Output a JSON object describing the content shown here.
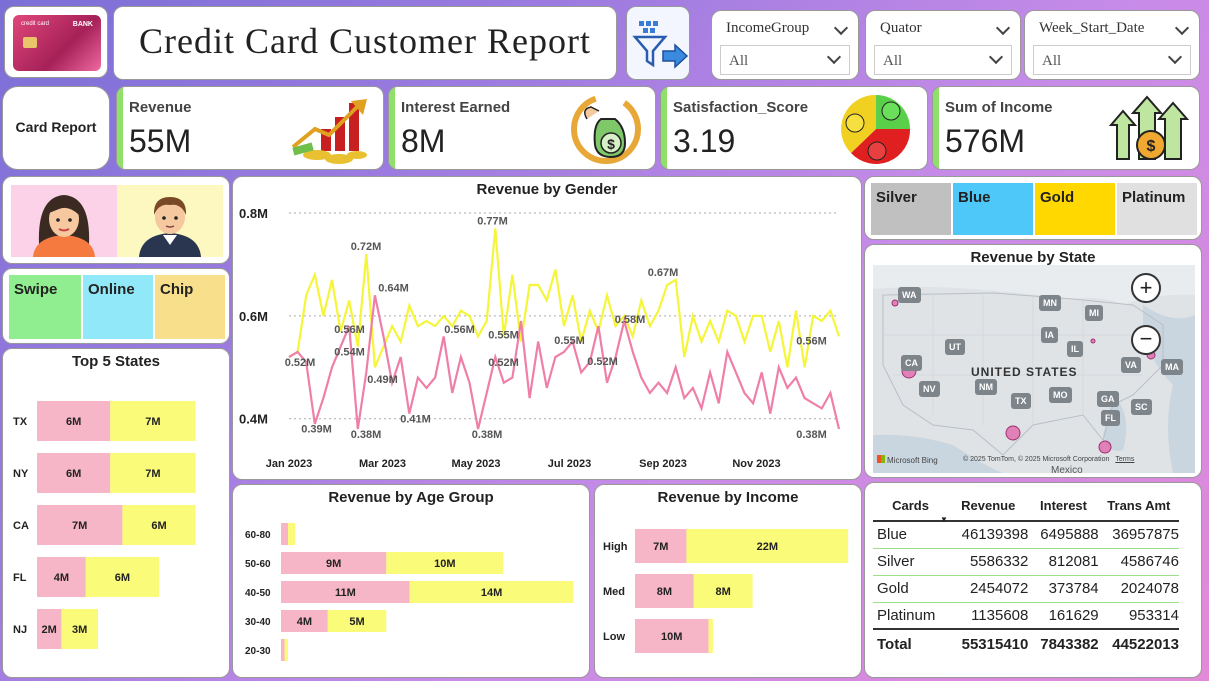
{
  "header": {
    "title": "Credit Card Customer Report",
    "card_image_bank": "BANK",
    "card_image_label": "credit card"
  },
  "slicers": [
    {
      "label": "IncomeGroup",
      "value": "All"
    },
    {
      "label": "Quator",
      "value": "All"
    },
    {
      "label": "Week_Start_Date",
      "value": "All"
    }
  ],
  "nav": {
    "card_report": "Card Report"
  },
  "kpis": [
    {
      "label": "Revenue",
      "value": "55M"
    },
    {
      "label": "Interest Earned",
      "value": "8M"
    },
    {
      "label": "Satisfaction_Score",
      "value": "3.19"
    },
    {
      "label": "Sum of Income",
      "value": "576M"
    }
  ],
  "txn_types": [
    "Swipe",
    "Online",
    "Chip"
  ],
  "card_buttons": [
    "Silver",
    "Blue",
    "Gold",
    "Platinum"
  ],
  "colors": {
    "female": "#f7b6c8",
    "male": "#fbfb7a",
    "line_female": "#ef7fa8",
    "line_male": "#f5f53a",
    "accent": "#8fe06a"
  },
  "top5": {
    "title": "Top 5 States",
    "rows": [
      {
        "state": "TX",
        "f": 6,
        "m": 7,
        "f_label": "6M",
        "m_label": "7M"
      },
      {
        "state": "NY",
        "f": 6,
        "m": 7,
        "f_label": "6M",
        "m_label": "7M"
      },
      {
        "state": "CA",
        "f": 7,
        "m": 6,
        "f_label": "7M",
        "m_label": "6M"
      },
      {
        "state": "FL",
        "f": 4,
        "m": 6,
        "f_label": "4M",
        "m_label": "6M"
      },
      {
        "state": "NJ",
        "f": 2,
        "m": 3,
        "f_label": "2M",
        "m_label": "3M"
      }
    ]
  },
  "gender_chart": {
    "title": "Revenue by Gender",
    "y_ticks": [
      "0.8M",
      "0.6M",
      "0.4M"
    ],
    "x_ticks": [
      "Jan 2023",
      "Mar 2023",
      "May 2023",
      "Jul 2023",
      "Sep 2023",
      "Nov 2023"
    ],
    "labels": [
      "0.52M",
      "0.72M",
      "0.64M",
      "0.56M",
      "0.54M",
      "0.49M",
      "0.39M",
      "0.38M",
      "0.41M",
      "0.56M",
      "0.77M",
      "0.55M",
      "0.52M",
      "0.38M",
      "0.55M",
      "0.58M",
      "0.52M",
      "0.67M",
      "0.56M",
      "0.38M"
    ]
  },
  "age_chart": {
    "title": "Revenue by Age Group",
    "rows": [
      {
        "group": "60-80",
        "f": 0.6,
        "m": 0.6,
        "f_label": "",
        "m_label": ""
      },
      {
        "group": "50-60",
        "f": 9,
        "m": 10,
        "f_label": "9M",
        "m_label": "10M"
      },
      {
        "group": "40-50",
        "f": 11,
        "m": 14,
        "f_label": "11M",
        "m_label": "14M"
      },
      {
        "group": "30-40",
        "f": 4,
        "m": 5,
        "f_label": "4M",
        "m_label": "5M"
      },
      {
        "group": "20-30",
        "f": 0.3,
        "m": 0.3,
        "f_label": "",
        "m_label": ""
      }
    ]
  },
  "income_chart": {
    "title": "Revenue by Income",
    "rows": [
      {
        "group": "High",
        "f": 7,
        "m": 22,
        "f_label": "7M",
        "m_label": "22M"
      },
      {
        "group": "Med",
        "f": 8,
        "m": 8,
        "f_label": "8M",
        "m_label": "8M"
      },
      {
        "group": "Low",
        "f": 10,
        "m": 0.6,
        "f_label": "10M",
        "m_label": ""
      }
    ]
  },
  "map": {
    "title": "Revenue by State",
    "country": "UNITED STATES",
    "states": [
      "WA",
      "MN",
      "MI",
      "UT",
      "IA",
      "IL",
      "CA",
      "NV",
      "NM",
      "TX",
      "MO",
      "VA",
      "MA",
      "GA",
      "FL",
      "SC"
    ],
    "credit": "© 2025 TomTom, © 2025 Microsoft Corporation",
    "terms": "Terms",
    "bing": "Microsoft Bing",
    "mexico": "Mexico"
  },
  "table": {
    "headers": [
      "Cards",
      "Revenue",
      "Interest",
      "Trans Amt"
    ],
    "rows": [
      [
        "Blue",
        "46139398",
        "6495888",
        "36957875"
      ],
      [
        "Silver",
        "5586332",
        "812081",
        "4586746"
      ],
      [
        "Gold",
        "2454072",
        "373784",
        "2024078"
      ],
      [
        "Platinum",
        "1135608",
        "161629",
        "953314"
      ]
    ],
    "total": [
      "Total",
      "55315410",
      "7843382",
      "44522013"
    ]
  },
  "chart_data": [
    {
      "type": "line",
      "title": "Revenue by Gender",
      "x": [
        "Jan 2023",
        "Mar 2023",
        "May 2023",
        "Jul 2023",
        "Sep 2023",
        "Nov 2023"
      ],
      "ylim": [
        0.38,
        0.8
      ],
      "series": [
        {
          "name": "",
          "color": "#f5f53a",
          "values": [
            0.52,
            0.53,
            0.64,
            0.68,
            0.6,
            0.67,
            0.57,
            0.63,
            0.54,
            0.72,
            0.5,
            0.54,
            0.58,
            0.55,
            0.62,
            0.58,
            0.59,
            0.58,
            0.6,
            0.58,
            0.61,
            0.6,
            0.56,
            0.59,
            0.77,
            0.56,
            0.68,
            0.55,
            0.66,
            0.66,
            0.63,
            0.69,
            0.58,
            0.64,
            0.55,
            0.61,
            0.57,
            0.64,
            0.58,
            0.6,
            0.56,
            0.63,
            0.58,
            0.61,
            0.66,
            0.67,
            0.52,
            0.6,
            0.55,
            0.59,
            0.55,
            0.61,
            0.6,
            0.55,
            0.6,
            0.6,
            0.53,
            0.59,
            0.5,
            0.61,
            0.5,
            0.6,
            0.59,
            0.61,
            0.56
          ]
        },
        {
          "name": "",
          "color": "#ef7fa8",
          "values": [
            0.52,
            0.53,
            0.51,
            0.39,
            0.44,
            0.5,
            0.54,
            0.58,
            0.38,
            0.49,
            0.64,
            0.56,
            0.47,
            0.52,
            0.41,
            0.48,
            0.46,
            0.48,
            0.56,
            0.45,
            0.52,
            0.47,
            0.38,
            0.45,
            0.52,
            0.47,
            0.48,
            0.59,
            0.44,
            0.55,
            0.46,
            0.52,
            0.53,
            0.55,
            0.49,
            0.51,
            0.58,
            0.47,
            0.52,
            0.59,
            0.53,
            0.48,
            0.45,
            0.47,
            0.45,
            0.5,
            0.44,
            0.46,
            0.42,
            0.49,
            0.43,
            0.53,
            0.49,
            0.45,
            0.43,
            0.49,
            0.41,
            0.5,
            0.46,
            0.48,
            0.44,
            0.43,
            0.42,
            0.45,
            0.38
          ]
        }
      ]
    },
    {
      "type": "bar",
      "title": "Top 5 States",
      "categories": [
        "TX",
        "NY",
        "CA",
        "FL",
        "NJ"
      ],
      "series": [
        {
          "name": "",
          "values": [
            6,
            6,
            7,
            4,
            2
          ]
        },
        {
          "name": "",
          "values": [
            7,
            7,
            6,
            6,
            3
          ]
        }
      ]
    },
    {
      "type": "bar",
      "title": "Revenue by Age Group",
      "categories": [
        "60-80",
        "50-60",
        "40-50",
        "30-40",
        "20-30"
      ],
      "series": [
        {
          "name": "",
          "values": [
            0.6,
            9,
            11,
            4,
            0.3
          ]
        },
        {
          "name": "",
          "values": [
            0.6,
            10,
            14,
            5,
            0.3
          ]
        }
      ]
    },
    {
      "type": "bar",
      "title": "Revenue by Income",
      "categories": [
        "High",
        "Med",
        "Low"
      ],
      "series": [
        {
          "name": "",
          "values": [
            7,
            8,
            10
          ]
        },
        {
          "name": "",
          "values": [
            22,
            8,
            0.6
          ]
        }
      ]
    }
  ]
}
